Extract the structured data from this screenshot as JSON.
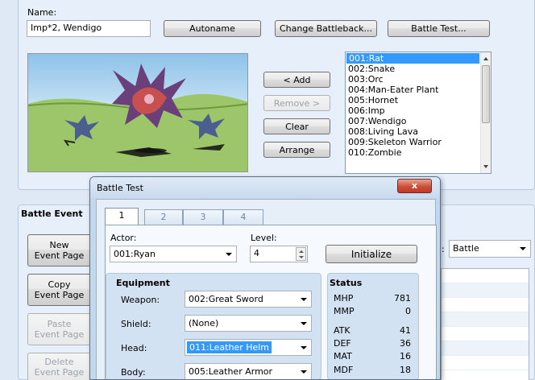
{
  "troop": {
    "name_label": "Name:",
    "name_value": "Imp*2, Wendigo",
    "autoname_button": "Autoname",
    "change_battleback_button": "Change Battleback...",
    "battle_test_button": "Battle Test...",
    "add_button": "< Add",
    "remove_button": "Remove >",
    "clear_button": "Clear",
    "arrange_button": "Arrange",
    "enemies": [
      "001:Rat",
      "002:Snake",
      "003:Orc",
      "004:Man-Eater Plant",
      "005:Hornet",
      "006:Imp",
      "007:Wendigo",
      "008:Living Lava",
      "009:Skeleton Warrior",
      "010:Zombie"
    ],
    "selected_enemy": "001:Rat"
  },
  "battle_event": {
    "title": "Battle Event",
    "new_page": [
      "New",
      "Event Page"
    ],
    "copy_page": [
      "Copy",
      "Event Page"
    ],
    "paste_page": [
      "Paste",
      "Event Page"
    ],
    "delete_page": [
      "Delete",
      "Event Page"
    ],
    "span_value": "Battle"
  },
  "dialog": {
    "title": "Battle Test",
    "close_icon": "x",
    "tabs": [
      "1",
      "2",
      "3",
      "4"
    ],
    "actor_label": "Actor:",
    "actor_value": "001:Ryan",
    "level_label": "Level:",
    "level_value": "4",
    "initialize_button": "Initialize",
    "equipment_label": "Equipment",
    "equipment": [
      {
        "slot": "Weapon:",
        "value": "002:Great Sword"
      },
      {
        "slot": "Shield:",
        "value": "(None)"
      },
      {
        "slot": "Head:",
        "value": "011:Leather Helm"
      },
      {
        "slot": "Body:",
        "value": "005:Leather Armor"
      }
    ],
    "status_label": "Status",
    "status": [
      {
        "name": "MHP",
        "value": "781"
      },
      {
        "name": "MMP",
        "value": "0"
      },
      {
        "name": "ATK",
        "value": "41"
      },
      {
        "name": "DEF",
        "value": "36"
      },
      {
        "name": "MAT",
        "value": "16"
      },
      {
        "name": "MDF",
        "value": "18"
      }
    ]
  }
}
